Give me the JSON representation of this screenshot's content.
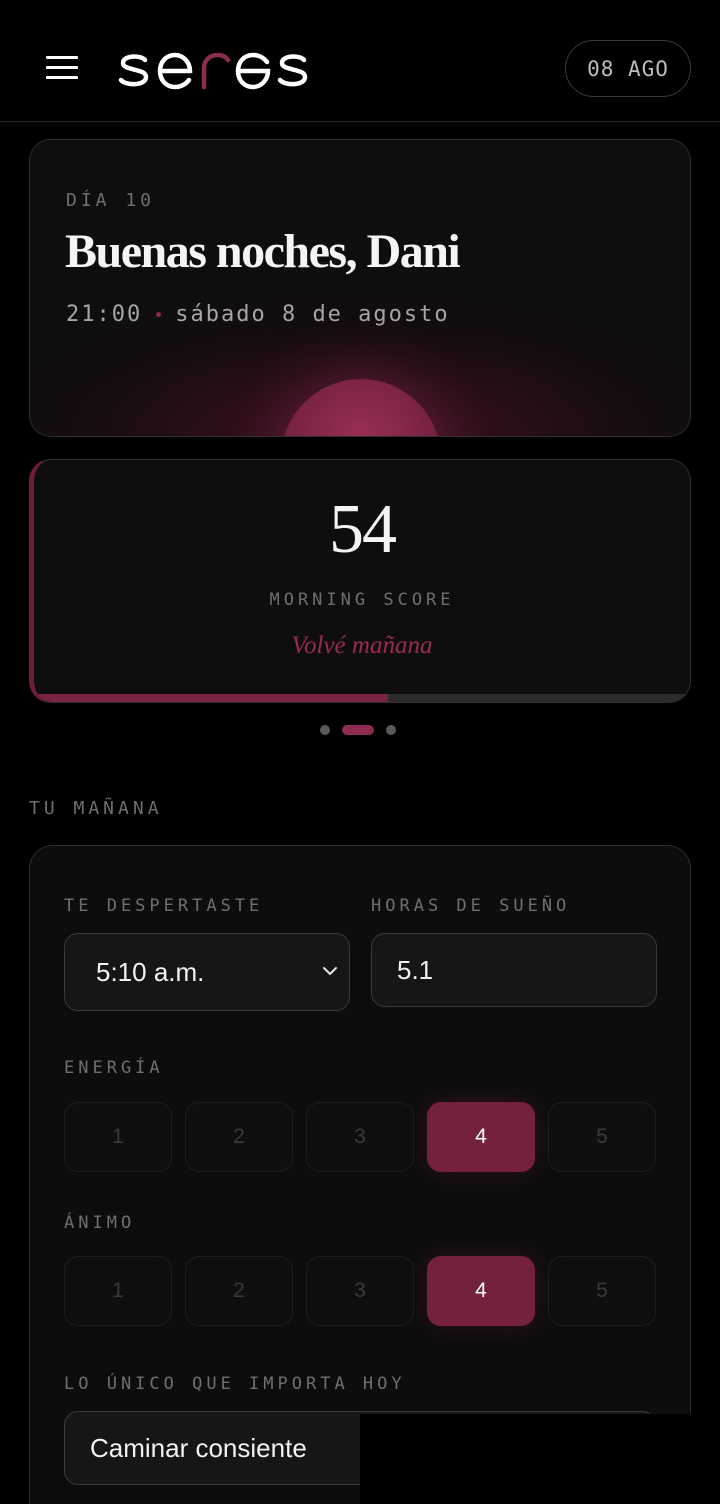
{
  "header": {
    "logo_text": "seres",
    "date_badge": "08 AGO"
  },
  "hero": {
    "day_label": "DÍA 10",
    "greeting": "Buenas noches, Dani",
    "time": "21:00",
    "date": "sábado 8 de agosto"
  },
  "score": {
    "value": "54",
    "label": "MORNING SCORE",
    "note": "Volvé mañana",
    "progress": 0.54
  },
  "carousel": {
    "page_count": 3,
    "active_index": 1
  },
  "morning": {
    "section_title": "TU MAÑANA",
    "woke_label": "TE DESPERTASTE",
    "woke_value": "5:10 a.m.",
    "sleep_label": "HORAS DE SUEÑO",
    "sleep_value": "5.1",
    "energy_label": "ENERGÍA",
    "energy_options": [
      "1",
      "2",
      "3",
      "4",
      "5"
    ],
    "energy_selected": "4",
    "mood_label": "ÁNIMO",
    "mood_options": [
      "1",
      "2",
      "3",
      "4",
      "5"
    ],
    "mood_selected": "4",
    "focus_label": "LO ÚNICO QUE IMPORTA HOY",
    "focus_value": "Caminar consiente"
  },
  "colors": {
    "accent": "#74203f",
    "accent_text": "#9a2a55",
    "background": "#000000",
    "card": "#0e0e0e"
  }
}
